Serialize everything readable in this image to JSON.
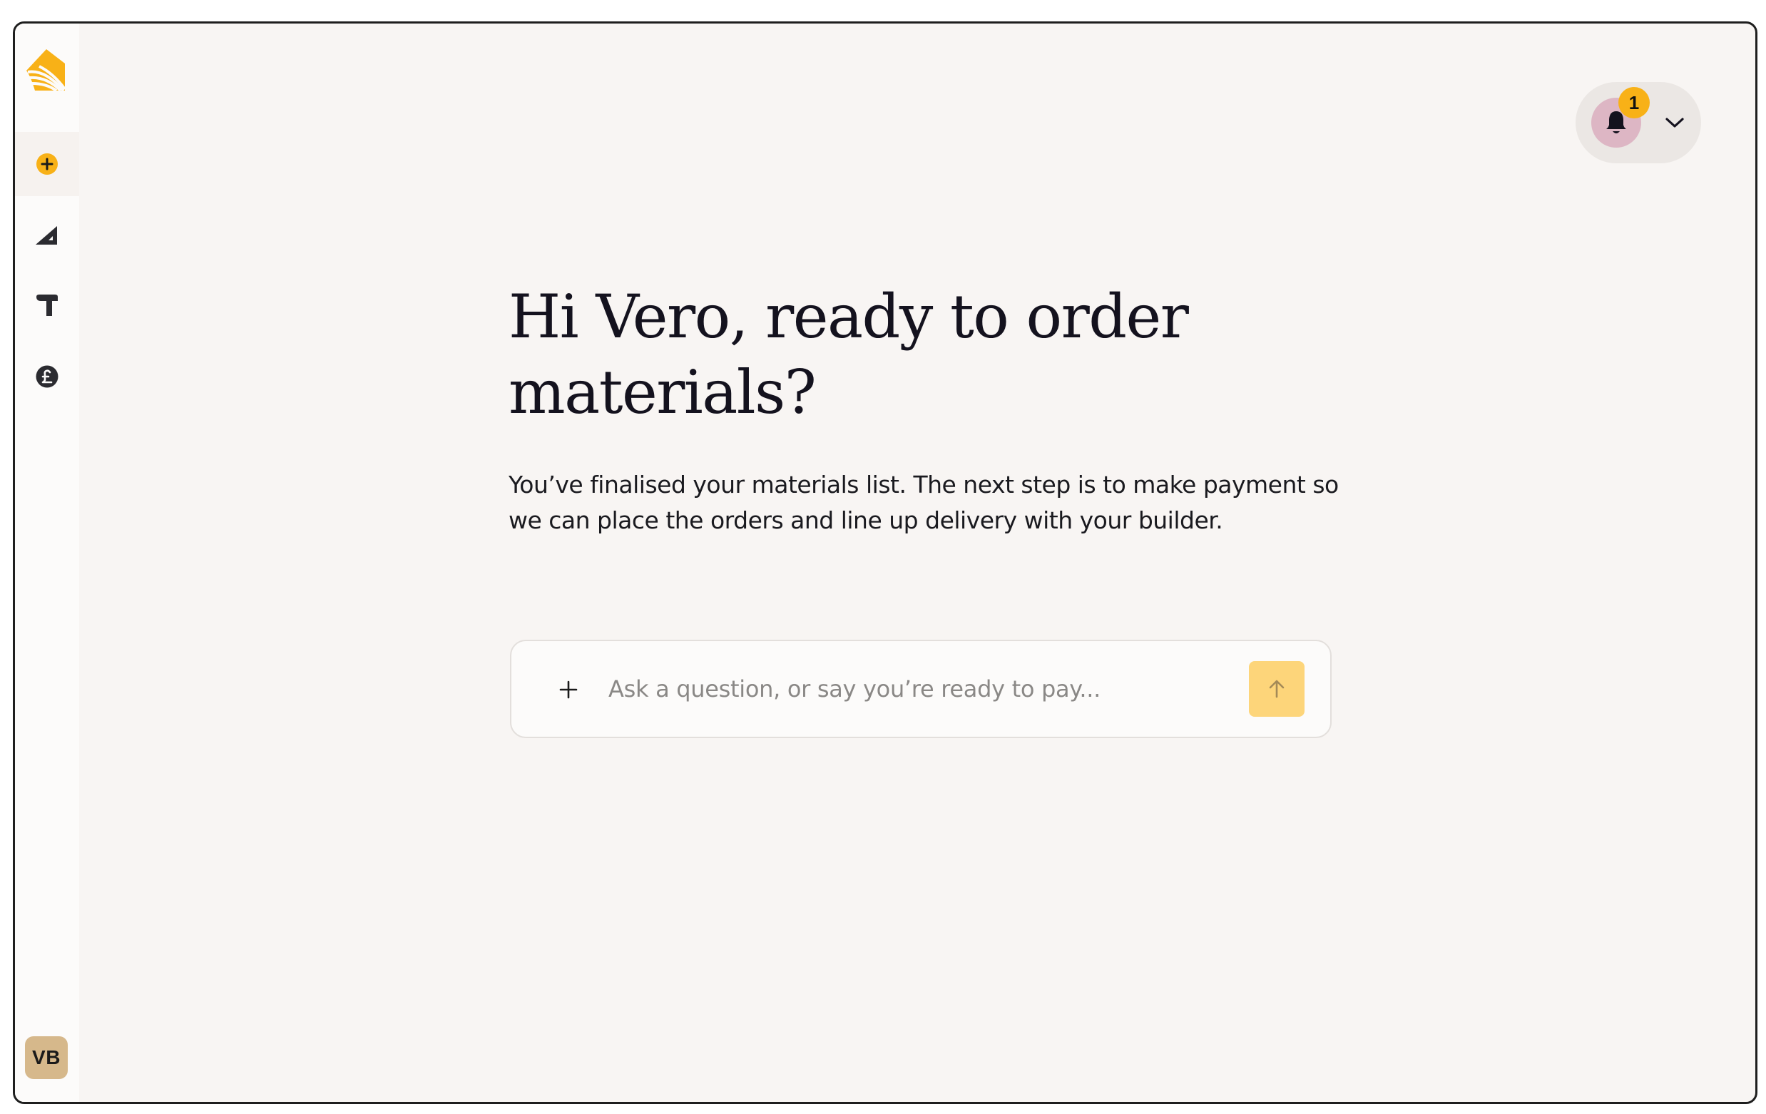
{
  "sidebar": {
    "logo": "sun-house-logo",
    "items": [
      {
        "icon": "plus-circle-icon",
        "active": true
      },
      {
        "icon": "set-square-icon",
        "active": false
      },
      {
        "icon": "hammer-icon",
        "active": false
      },
      {
        "icon": "pound-circle-icon",
        "active": false
      }
    ],
    "avatar_initials": "VB"
  },
  "header": {
    "notification_count": "1",
    "notification_icon": "bell-icon",
    "menu_icon": "chevron-down-icon"
  },
  "main": {
    "headline": "Hi Vero, ready to order materials?",
    "subtext": "You’ve finalised your materials list. The next step is to make payment so we can place the orders and line up delivery with your builder.",
    "composer": {
      "placeholder": "Ask a question, or say you’re ready to pay...",
      "value": ""
    }
  },
  "colors": {
    "brand": "#f8b117",
    "background": "#f8f5f3",
    "send_button": "#fdd57a",
    "bell_background": "#ddb6c4",
    "avatar": "#d6b88b"
  }
}
